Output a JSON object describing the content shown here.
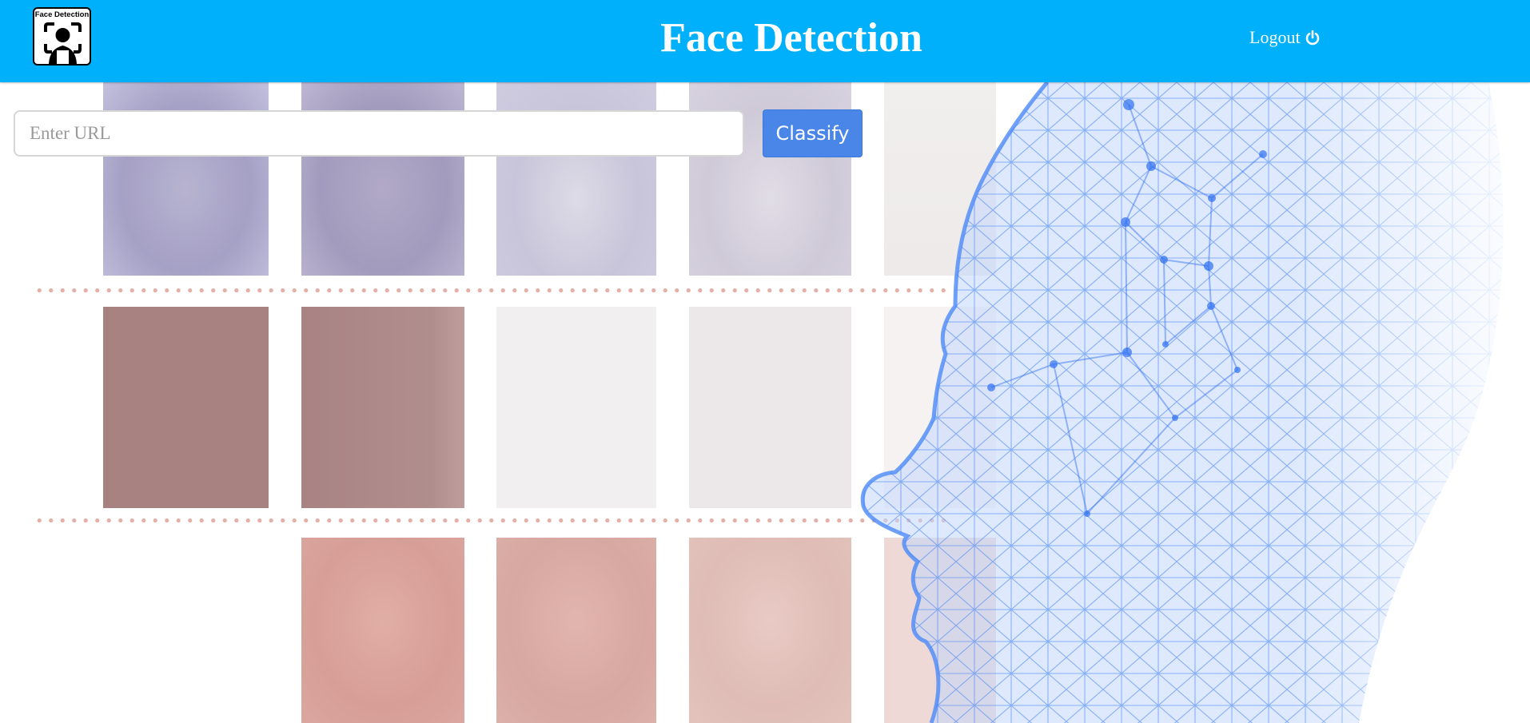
{
  "header": {
    "logo_text": "Face Detection",
    "title": "Face Detection",
    "logout_label": "Logout",
    "logout_icon": "power-icon"
  },
  "search": {
    "placeholder": "Enter URL",
    "value": "",
    "classify_label": "Classify"
  },
  "colors": {
    "header_bg": "#00b0fb",
    "button_bg": "#4a86e8",
    "mesh_blue": "#4f8fff"
  }
}
